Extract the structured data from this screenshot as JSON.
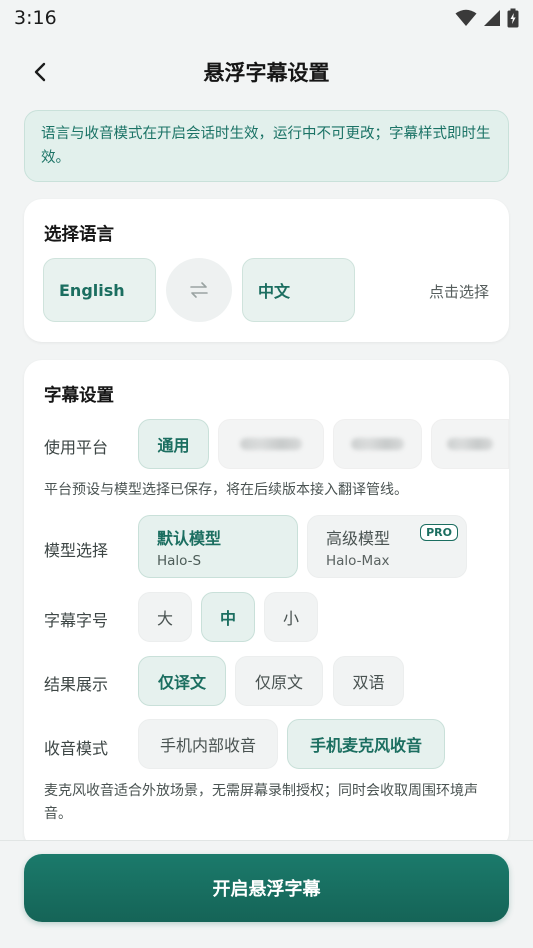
{
  "status_bar": {
    "time": "3:16",
    "icons": [
      "wifi-icon",
      "signal-icon",
      "battery-icon"
    ]
  },
  "header": {
    "title": "悬浮字幕设置",
    "back_icon": "chevron-left-icon"
  },
  "notice": {
    "text": "语言与收音模式在开启会话时生效，运行中不可更改；字幕样式即时生效。"
  },
  "language_section": {
    "title": "选择语言",
    "source_language": "English",
    "target_language": "中文",
    "swap_icon": "swap-arrows-icon",
    "hint": "点击选择"
  },
  "subtitle_section": {
    "title": "字幕设置",
    "platform": {
      "label": "使用平台",
      "options": [
        "通用"
      ],
      "selected": "通用",
      "help": "平台预设与模型选择已保存，将在后续版本接入翻译管线。"
    },
    "model": {
      "label": "模型选择",
      "options": [
        {
          "name": "默认模型",
          "sub": "Halo-S"
        },
        {
          "name": "高级模型",
          "sub": "Halo-Max",
          "badge": "PRO"
        }
      ],
      "selected": "默认模型"
    },
    "font_size": {
      "label": "字幕字号",
      "options": [
        "大",
        "中",
        "小"
      ],
      "selected": "中"
    },
    "display": {
      "label": "结果展示",
      "options": [
        "仅译文",
        "仅原文",
        "双语"
      ],
      "selected": "仅译文"
    },
    "audio": {
      "label": "收音模式",
      "options": [
        "手机内部收音",
        "手机麦克风收音"
      ],
      "selected": "手机麦克风收音",
      "help": "麦克风收音适合外放场景，无需屏幕录制授权；同时会收取周围环境声音。"
    }
  },
  "primary_action": {
    "label": "开启悬浮字幕"
  },
  "colors": {
    "accent": "#1b6e60",
    "accent_bg": "#e6f1ee",
    "notice_bg": "#e2f0ec",
    "button": "#1b7a6b",
    "page_bg": "#f2f4f4"
  }
}
